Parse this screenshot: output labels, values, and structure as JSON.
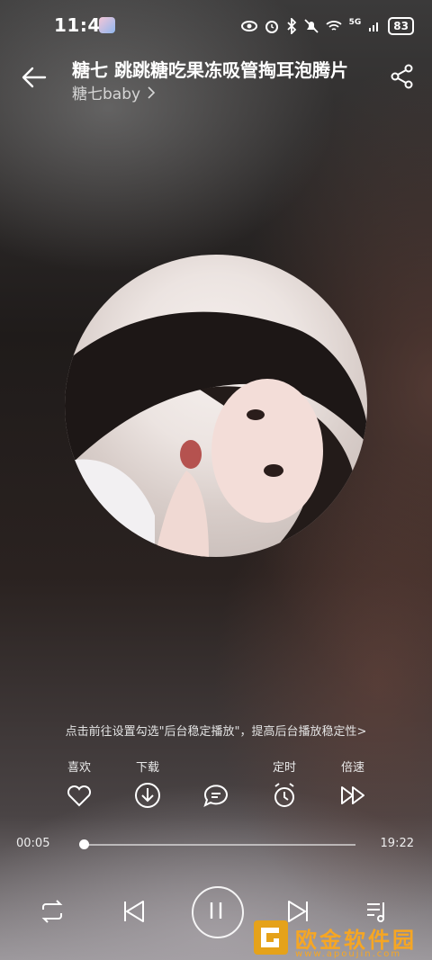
{
  "status": {
    "time": "11:44",
    "battery": "83",
    "network": "5G"
  },
  "header": {
    "title": "糖七 跳跳糖吃果冻吸管掏耳泡腾片",
    "artist": "糖七baby"
  },
  "hint": "点击前往设置勾选\"后台稳定播放\"，提高后台播放稳定性>",
  "actions": {
    "like": "喜欢",
    "download": "下载",
    "comment": "",
    "timer": "定时",
    "speed": "倍速"
  },
  "progress": {
    "current": "00:05",
    "total": "19:22",
    "fraction": 0.004
  },
  "watermark": {
    "title": "欧金软件园",
    "url": "www.apoujin.com"
  },
  "colors": {
    "accent": "#ffffff",
    "watermark": "#f6a623"
  }
}
